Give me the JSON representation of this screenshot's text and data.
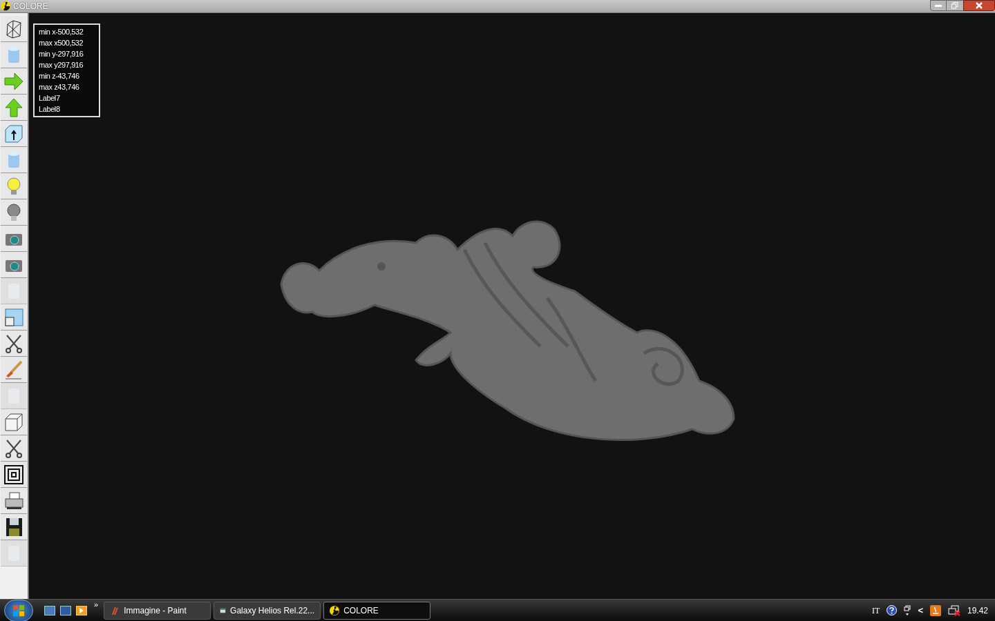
{
  "window": {
    "title": "COLORE"
  },
  "toolbar": [
    {
      "kind": "wireframe",
      "disabled": false
    },
    {
      "kind": "cylinder",
      "disabled": false
    },
    {
      "kind": "arrow-right",
      "disabled": false
    },
    {
      "kind": "arrow-up",
      "disabled": false
    },
    {
      "kind": "cube-arrow",
      "disabled": false
    },
    {
      "kind": "cylinder",
      "disabled": false
    },
    {
      "kind": "bulb-on",
      "disabled": false
    },
    {
      "kind": "bulb-off",
      "disabled": false
    },
    {
      "kind": "camera",
      "disabled": false
    },
    {
      "kind": "camera",
      "disabled": false
    },
    {
      "kind": "blank",
      "disabled": true
    },
    {
      "kind": "windows",
      "disabled": false
    },
    {
      "kind": "scissors",
      "disabled": false
    },
    {
      "kind": "brush",
      "disabled": false
    },
    {
      "kind": "blank",
      "disabled": true
    },
    {
      "kind": "cube",
      "disabled": false
    },
    {
      "kind": "scissors",
      "disabled": false
    },
    {
      "kind": "concentric",
      "disabled": false
    },
    {
      "kind": "printer",
      "disabled": false
    },
    {
      "kind": "floppy",
      "disabled": false
    },
    {
      "kind": "blank",
      "disabled": true
    }
  ],
  "info_panel": [
    "min x-500,532",
    "max x500,532",
    "min y-297,916",
    "max y297,916",
    "min z-43,746",
    "max z43,746",
    "Label7",
    "Label8"
  ],
  "taskbar": {
    "quick_launch_more": "»",
    "tasks": [
      {
        "label": "Immagine - Paint",
        "kind": "paint",
        "selected": false
      },
      {
        "label": "Galaxy Helios  Rel.22...",
        "kind": "app",
        "selected": false
      },
      {
        "label": "COLORE",
        "kind": "colore",
        "selected": true
      }
    ],
    "tray": {
      "language": "IT",
      "time": "19.42",
      "expand": "<"
    }
  }
}
